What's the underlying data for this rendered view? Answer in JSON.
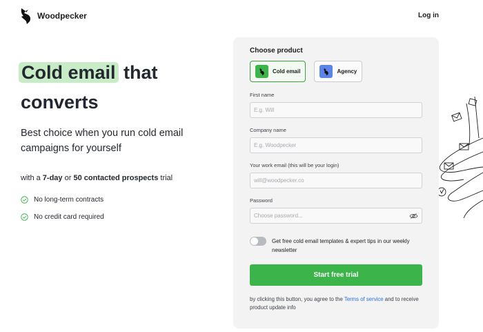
{
  "brand": {
    "name": "Woodpecker"
  },
  "nav": {
    "login": "Log in"
  },
  "hero": {
    "headline_highlight": "Cold email",
    "headline_rest_1": "that",
    "headline_rest_2": "converts",
    "subline": "Best choice when you run cold email campaigns for yourself",
    "trial_prefix": "with a ",
    "trial_days": "7-day",
    "trial_mid": " or ",
    "trial_prospects": "50 contacted prospects",
    "trial_suffix": " trial",
    "benefits": [
      "No long-term contracts",
      "No credit card required"
    ]
  },
  "form": {
    "choose_product": "Choose product",
    "products": [
      {
        "label": "Cold email",
        "selected": true
      },
      {
        "label": "Agency",
        "selected": false
      }
    ],
    "first_name": {
      "label": "First name",
      "placeholder": "E.g. Will",
      "value": ""
    },
    "company_name": {
      "label": "Company name",
      "placeholder": "E.g. Woodpecker",
      "value": ""
    },
    "work_email": {
      "label": "Your work email (this will be your login)",
      "placeholder": "will@woodpecker.co",
      "value": ""
    },
    "password": {
      "label": "Password",
      "placeholder": "Choose password...",
      "value": ""
    },
    "newsletter": {
      "text": "Get free cold email templates & expert tips in our weekly newsletter",
      "enabled": false
    },
    "submit": "Start free trial",
    "legal_prefix": "by clicking this button, you agree to the ",
    "legal_link": "Terms of service",
    "legal_suffix": " and to receive product update info"
  },
  "colors": {
    "accent_green": "#3bb54a",
    "highlight_green": "#c8ecc6",
    "agency_blue": "#5b84e8",
    "link_blue": "#2a6fe0"
  },
  "icons": {
    "logo": "woodpecker-bird-icon",
    "benefit": "check-circle-icon",
    "password_toggle": "eye-off-icon"
  }
}
